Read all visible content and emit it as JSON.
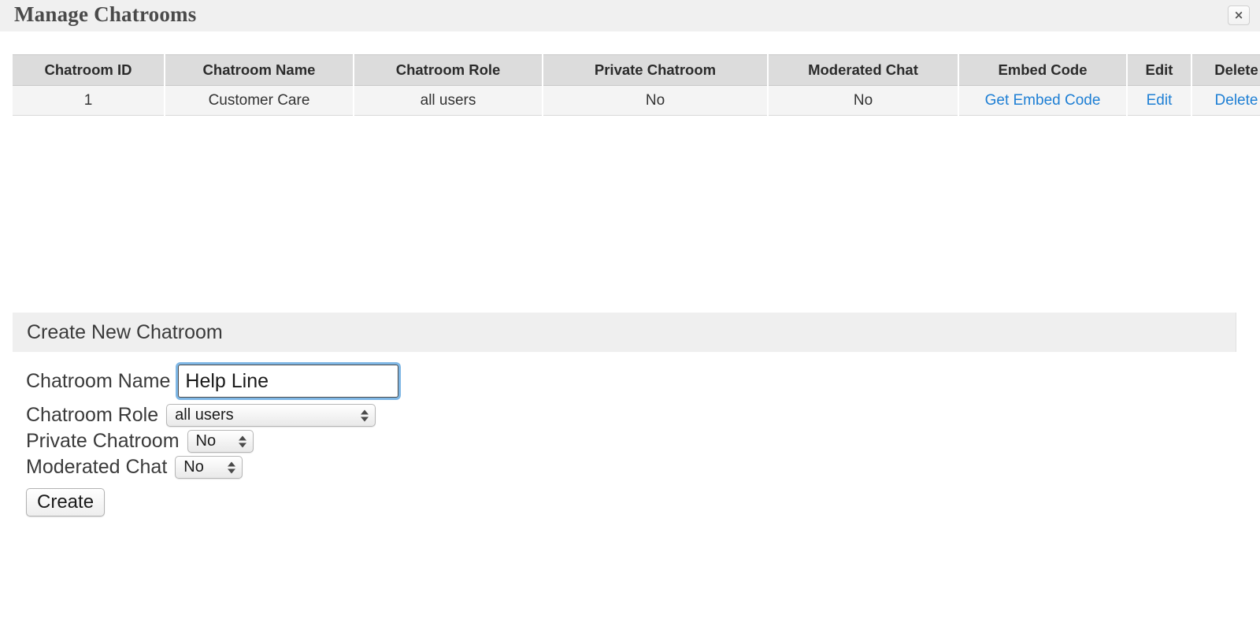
{
  "window": {
    "title": "Manage Chatrooms",
    "close_label": "×"
  },
  "table": {
    "headers": {
      "id": "Chatroom ID",
      "name": "Chatroom Name",
      "role": "Chatroom Role",
      "private": "Private Chatroom",
      "moderated": "Moderated Chat",
      "embed": "Embed Code",
      "edit": "Edit",
      "delete": "Delete"
    },
    "rows": [
      {
        "id": "1",
        "name": "Customer Care",
        "role": "all users",
        "private": "No",
        "moderated": "No",
        "embed": "Get Embed Code",
        "edit": "Edit",
        "delete": "Delete"
      }
    ]
  },
  "create_section": {
    "title": "Create New Chatroom",
    "fields": {
      "name_label": "Chatroom Name",
      "name_value": "Help Line",
      "name_placeholder": "",
      "role_label": "Chatroom Role",
      "role_value": "all users",
      "private_label": "Private Chatroom",
      "private_value": "No",
      "moderated_label": "Moderated Chat",
      "moderated_value": "No"
    },
    "submit_label": "Create"
  },
  "colors": {
    "link": "#1e7fd4",
    "header_band": "#f0f0f0",
    "table_header": "#dcdcdc",
    "row_bg": "#f4f4f4",
    "focus_ring": "#69aae1"
  }
}
